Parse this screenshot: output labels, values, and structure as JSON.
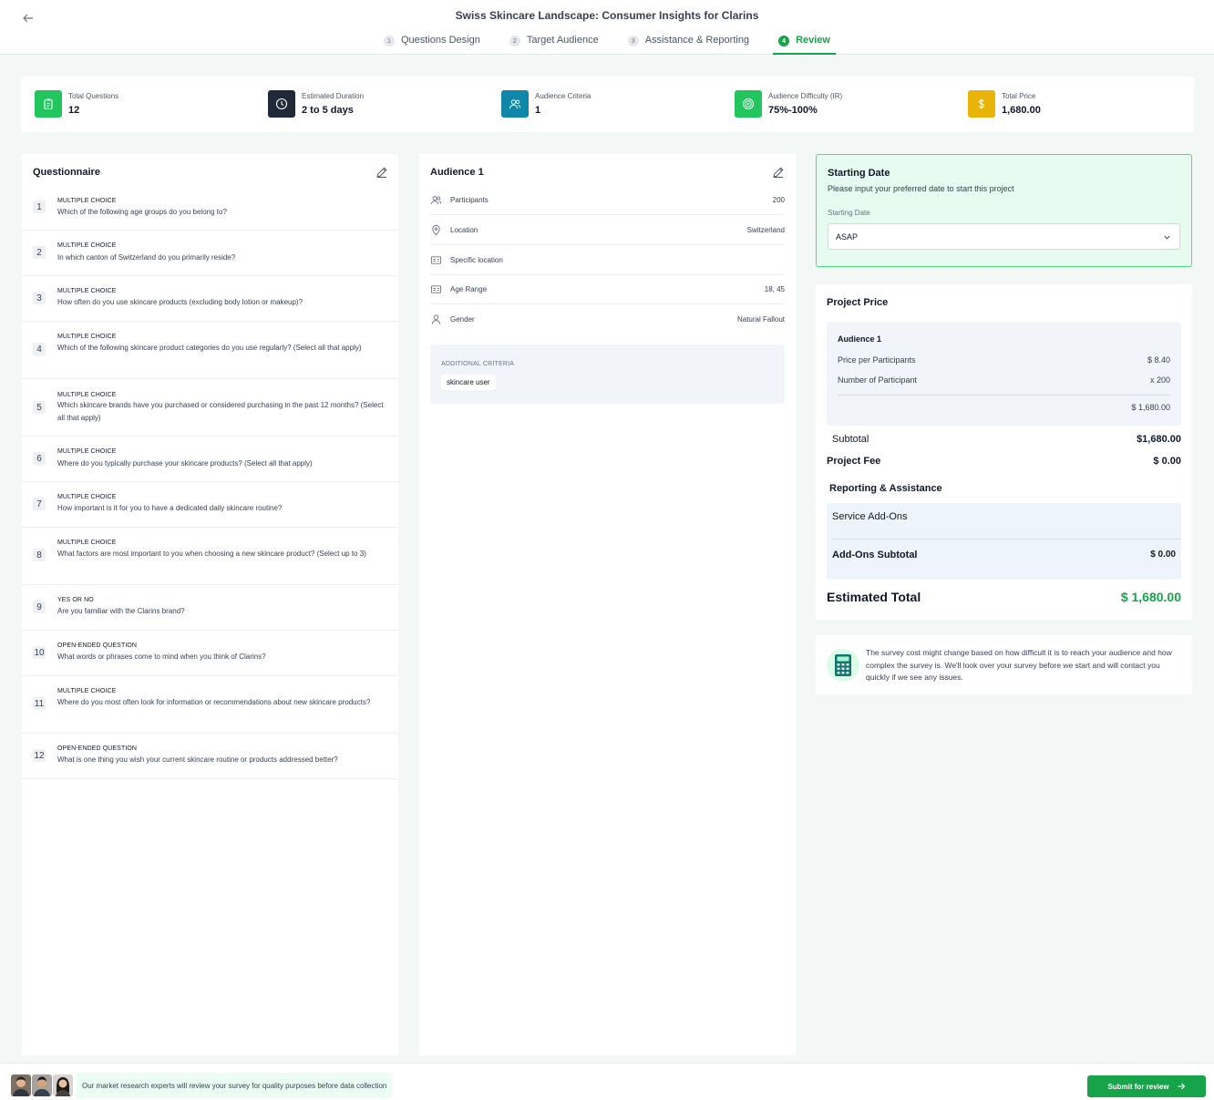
{
  "header": {
    "title": "Swiss Skincare Landscape: Consumer Insights for Clarins",
    "steps": [
      {
        "num": "1",
        "label": "Questions Design"
      },
      {
        "num": "2",
        "label": "Target Audience"
      },
      {
        "num": "3",
        "label": "Assistance & Reporting"
      },
      {
        "num": "4",
        "label": "Review"
      }
    ]
  },
  "stats": [
    {
      "label": "Total Questions",
      "value": "12",
      "icon": "clipboard-icon",
      "color": "#22c55e"
    },
    {
      "label": "Estimated Duration",
      "value": "2 to 5 days",
      "icon": "clock-icon",
      "color": "#1f2937"
    },
    {
      "label": "Audience Criteria",
      "value": "1",
      "icon": "users-icon",
      "color": "#0e87a8"
    },
    {
      "label": "Audience Difficulty (IR)",
      "value": "75%-100%",
      "icon": "target-icon",
      "color": "#22c55e"
    },
    {
      "label": "Total Price",
      "value": "1,680.00",
      "icon": "dollar-icon",
      "color": "#eab308"
    }
  ],
  "questionnaire": {
    "title": "Questionnaire",
    "questions": [
      {
        "num": "1",
        "type": "MULTIPLE CHOICE",
        "text": "Which of the following age groups do you belong to?"
      },
      {
        "num": "2",
        "type": "MULTIPLE CHOICE",
        "text": "In which canton of Switzerland do you primarily reside?"
      },
      {
        "num": "3",
        "type": "MULTIPLE CHOICE",
        "text": "How often do you use skincare products (excluding body lotion or makeup)?"
      },
      {
        "num": "4",
        "type": "MULTIPLE CHOICE",
        "text": "Which of the following skincare product categories do you use regularly? (Select all that apply)"
      },
      {
        "num": "5",
        "type": "MULTIPLE CHOICE",
        "text": "Which skincare brands have you purchased or considered purchasing in the past 12 months? (Select all that apply)"
      },
      {
        "num": "6",
        "type": "MULTIPLE CHOICE",
        "text": "Where do you typically purchase your skincare products? (Select all that apply)"
      },
      {
        "num": "7",
        "type": "MULTIPLE CHOICE",
        "text": "How important is it for you to have a dedicated daily skincare routine?"
      },
      {
        "num": "8",
        "type": "MULTIPLE CHOICE",
        "text": "What factors are most important to you when choosing a new skincare product? (Select up to 3)"
      },
      {
        "num": "9",
        "type": "YES OR NO",
        "text": "Are you familiar with the Clarins brand?"
      },
      {
        "num": "10",
        "type": "OPEN-ENDED QUESTION",
        "text": "What words or phrases come to mind when you think of Clarins?"
      },
      {
        "num": "11",
        "type": "MULTIPLE CHOICE",
        "text": "Where do you most often look for information or recommendations about new skincare products?"
      },
      {
        "num": "12",
        "type": "OPEN-ENDED QUESTION",
        "text": "What is one thing you wish your current skincare routine or products addressed better?"
      }
    ]
  },
  "audience": {
    "title": "Audience 1",
    "rows": [
      {
        "label": "Participants",
        "value": "200",
        "icon": "users-icon"
      },
      {
        "label": "Location",
        "value": "Switzerland",
        "icon": "location-pin-icon"
      },
      {
        "label": "Specific location",
        "value": "",
        "icon": "id-card-icon"
      },
      {
        "label": "Age Range",
        "value": "18, 45",
        "icon": "id-card-icon"
      },
      {
        "label": "Gender",
        "value": "Natural Fallout",
        "icon": "user-icon"
      }
    ],
    "additional_label": "ADDITIONAL CRITERIA",
    "tag": "skincare user"
  },
  "starting_date": {
    "title": "Starting Date",
    "subtitle": "Please input your preferred date to start this project",
    "field_label": "Starting Date",
    "value": "ASAP"
  },
  "project_price": {
    "title": "Project Price",
    "audience_name": "Audience 1",
    "price_per_label": "Price per Participants",
    "price_per_value": "$ 8.40",
    "num_label": "Number of Participant",
    "num_value": "x 200",
    "audience_total": "$ 1,680.00",
    "subtotal_label": "Subtotal",
    "subtotal_value": "$1,680.00",
    "fee_label": "Project Fee",
    "fee_value": "$ 0.00",
    "reporting_label": "Reporting & Assistance",
    "addons_label": "Service Add-Ons",
    "addons_subtotal_label": "Add-Ons Subtotal",
    "addons_subtotal_value": "$ 0.00",
    "estimated_label": "Estimated Total",
    "estimated_value": "$ 1,680.00"
  },
  "note": {
    "text": "The survey cost might change based on how difficult it is to reach your audience and how complex the survey is. We'll look over your survey before we start and will contact you quickly if we see any issues."
  },
  "footer": {
    "note": "Our market research experts will review your survey for quality purposes before data collection",
    "submit_label": "Submit for review"
  },
  "colors": {
    "accent": "#16a34a",
    "accent_light": "#e8fbf1"
  }
}
